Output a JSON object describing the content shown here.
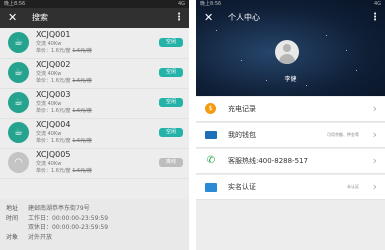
{
  "left": {
    "status": {
      "time": "晚上8:56",
      "right": "4G"
    },
    "title": "搜索",
    "stations": [
      {
        "code": "XCJQ001",
        "line1": "交流    40Kw",
        "price_label": "单价：1.6元/度",
        "price_old": "1.6元/度",
        "status": "空闲",
        "online": true
      },
      {
        "code": "XCJQ002",
        "line1": "交流    40Kw",
        "price_label": "单价：1.6元/度",
        "price_old": "1.6元/度",
        "status": "空闲",
        "online": true
      },
      {
        "code": "XCJQ003",
        "line1": "交流    40Kw",
        "price_label": "单价：1.6元/度",
        "price_old": "1.6元/度",
        "status": "空闲",
        "online": true
      },
      {
        "code": "XCJQ004",
        "line1": "交流    40Kw",
        "price_label": "单价：1.6元/度",
        "price_old": "1.6元/度",
        "status": "空闲",
        "online": true
      },
      {
        "code": "XCJQ005",
        "line1": "交流    40Kw",
        "price_label": "单价：1.6元/度",
        "price_old": "1.6元/度",
        "status": "离线",
        "online": false
      }
    ],
    "info": {
      "addr_label": "地址",
      "addr": "建邺南湖恭亭东街79号",
      "time_label": "时间",
      "workday": "工作日：00:00:00-23:59:59",
      "weekend": "双休日：00:00:00-23:59:59",
      "target_label": "对象",
      "target": "对外开放"
    }
  },
  "right": {
    "status": {
      "time": "晚上8:56",
      "right": "4G"
    },
    "title": "个人中心",
    "user_name": "李健",
    "menu": [
      {
        "label": "充电记录",
        "hint": "",
        "icon": "coin-icon"
      },
      {
        "label": "我的钱包",
        "hint": "可用余额、押金等",
        "icon": "wallet-icon"
      },
      {
        "label": "客服热线:400-8288-517",
        "hint": "",
        "icon": "phone-icon"
      },
      {
        "label": "实名认证",
        "hint": "未认证",
        "icon": "id-card-icon"
      }
    ],
    "colors": {
      "accent": "#25a38f",
      "badge": "#25b3a9",
      "dark_bar": "#303030"
    }
  }
}
